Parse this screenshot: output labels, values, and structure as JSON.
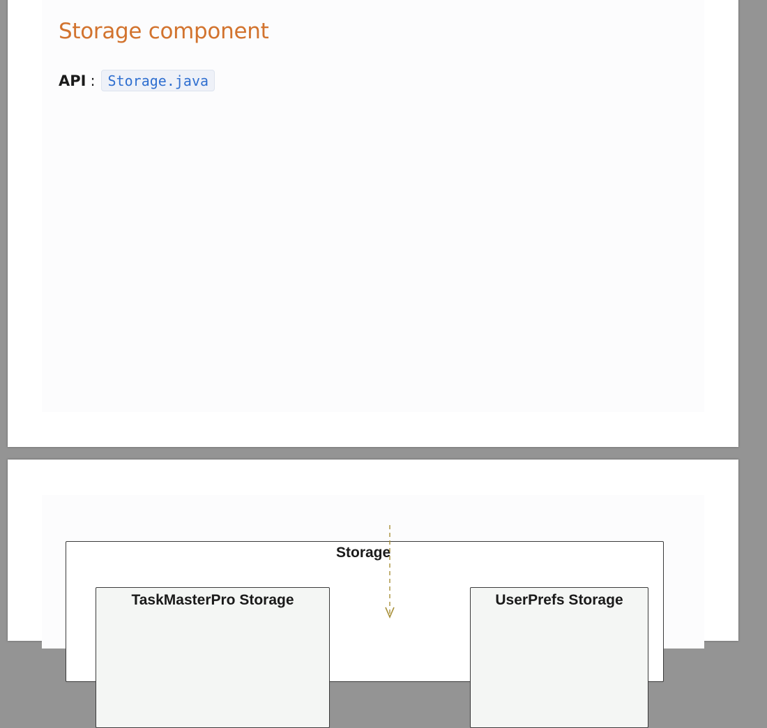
{
  "section": {
    "title": "Storage component",
    "api_label": "API",
    "api_separator": ":",
    "api_link_text": "Storage.java"
  },
  "diagram": {
    "storage_title": "Storage",
    "components": [
      {
        "title": "TaskMasterPro Storage"
      },
      {
        "title": "UserPrefs Storage"
      }
    ],
    "arrow_color": "#a8903a"
  }
}
